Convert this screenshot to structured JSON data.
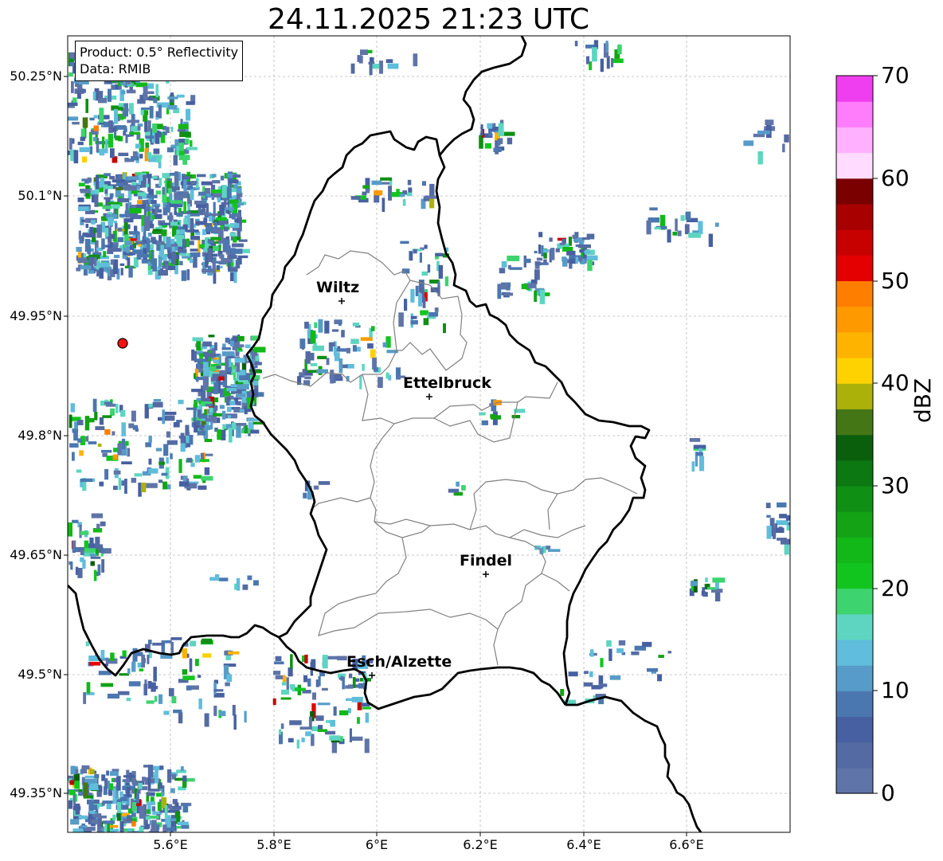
{
  "title": "24.11.2025 21:23 UTC",
  "info": {
    "product": "Product: 0.5° Reflectivity",
    "data_source": "Data: RMIB"
  },
  "lat_labels": [
    "50.25°N",
    "50.1°N",
    "49.95°N",
    "49.8°N",
    "49.65°N",
    "49.5°N",
    "49.35°N"
  ],
  "lon_labels": [
    "5.6°E",
    "5.8°E",
    "6°E",
    "6.2°E",
    "6.4°E",
    "6.6°E"
  ],
  "cities": [
    {
      "name": "Wiltz",
      "lon": 5.93,
      "lat": 49.967
    },
    {
      "name": "Ettelbruck",
      "lon": 6.1,
      "lat": 49.848
    },
    {
      "name": "Findel",
      "lon": 6.21,
      "lat": 49.624
    },
    {
      "name": "Esch/Alzette",
      "lon": 5.98,
      "lat": 49.497
    }
  ],
  "radar_site": {
    "lon": 5.505,
    "lat": 49.914
  },
  "colorbar": {
    "label": "dBZ",
    "ticks": [
      "0",
      "10",
      "20",
      "30",
      "40",
      "50",
      "60",
      "70"
    ],
    "min": 0,
    "max": 70,
    "colors": [
      "#5f74a8",
      "#536aa3",
      "#4760a1",
      "#4b77b0",
      "#579cc8",
      "#60bddb",
      "#5dd5c1",
      "#3dd36e",
      "#12c51e",
      "#12b818",
      "#13a315",
      "#0f8f14",
      "#0b7811",
      "#0a5f0d",
      "#457616",
      "#abb109",
      "#fed200",
      "#feb300",
      "#fe9a00",
      "#fe7f00",
      "#e40000",
      "#c70000",
      "#a80000",
      "#7a0000",
      "#ffdcff",
      "#ffb1ff",
      "#ff7cfb",
      "#ee3eef"
    ]
  }
}
